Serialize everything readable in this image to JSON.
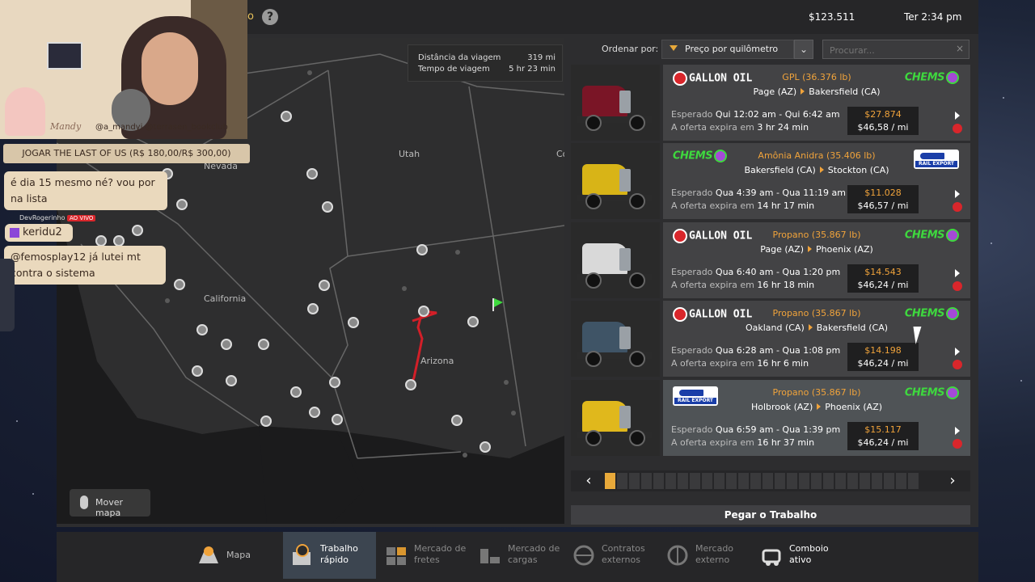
{
  "header": {
    "partial_title": "o",
    "help_label": "?",
    "money": "$123.511",
    "time": "Ter 2:34 pm"
  },
  "map": {
    "info": {
      "distance_label": "Distância da viagem",
      "distance_value": "319 mi",
      "time_label": "Tempo de viagem",
      "time_value": "5 hr 23 min"
    },
    "state_labels": [
      "Nevada",
      "Utah",
      "California",
      "Arizona",
      "Co"
    ],
    "move_map_label": "Mover mapa",
    "route_color": "#d21f28"
  },
  "sort": {
    "label": "Ordenar por:",
    "selected": "Preço por quilômetro",
    "dropdown_icon": "chevron-down",
    "search_placeholder": "Procurar..."
  },
  "jobs": [
    {
      "truck_color": "#7a1526",
      "source_logo": "GALLON OIL",
      "dest_logo": "CHEMS",
      "cargo": "GPL (36.376 lb)",
      "from": "Page (AZ)",
      "to": "Bakersfield (CA)",
      "esp_label": "Esperado",
      "esp_value": "Qui 12:02 am - Qui 6:42 am",
      "exp_label": "A oferta expira em",
      "exp_value": "3 hr 24 min",
      "price": "$27.874",
      "per_mile": "$46,58 / mi"
    },
    {
      "truck_color": "#d8b417",
      "source_logo": "CHEMS",
      "dest_logo": "RAIL EXPORT",
      "cargo": "Amônia Anidra (35.406 lb)",
      "from": "Bakersfield (CA)",
      "to": "Stockton (CA)",
      "esp_label": "Esperado",
      "esp_value": "Qua 4:39 am - Qua 11:19 am",
      "exp_label": "A oferta expira em",
      "exp_value": "14 hr 17 min",
      "price": "$11.028",
      "per_mile": "$46,57 / mi"
    },
    {
      "truck_color": "#d9d9d9",
      "source_logo": "GALLON OIL",
      "dest_logo": "CHEMS",
      "cargo": "Propano (35.867 lb)",
      "from": "Page (AZ)",
      "to": "Phoenix (AZ)",
      "esp_label": "Esperado",
      "esp_value": "Qua 6:40 am - Qua 1:20 pm",
      "exp_label": "A oferta expira em",
      "exp_value": "16 hr 18 min",
      "price": "$14.543",
      "per_mile": "$46,24 / mi"
    },
    {
      "truck_color": "#3f5466",
      "source_logo": "GALLON OIL",
      "dest_logo": "CHEMS",
      "cargo": "Propano (35.867 lb)",
      "from": "Oakland (CA)",
      "to": "Bakersfield (CA)",
      "esp_label": "Esperado",
      "esp_value": "Qua 6:28 am - Qua 1:08 pm",
      "exp_label": "A oferta expira em",
      "exp_value": "16 hr 6 min",
      "price": "$14.198",
      "per_mile": "$46,24 / mi"
    },
    {
      "truck_color": "#e0b81c",
      "source_logo": "RAIL EXPORT",
      "dest_logo": "CHEMS",
      "cargo": "Propano (35.867 lb)",
      "from": "Holbrook (AZ)",
      "to": "Phoenix (AZ)",
      "esp_label": "Esperado",
      "esp_value": "Qua 6:59 am - Qua 1:39 pm",
      "exp_label": "A oferta expira em",
      "exp_value": "16 hr 37 min",
      "price": "$15.117",
      "per_mile": "$46,24 / mi"
    }
  ],
  "pager": {
    "prev": "‹",
    "next": "›",
    "current_page": 1
  },
  "take_job_label": "Pegar o Trabalho",
  "nav": [
    {
      "label": "Mapa",
      "icon": "map-icon",
      "active": false
    },
    {
      "label": "Trabalho rápido",
      "icon": "clock-icon",
      "active": true
    },
    {
      "label": "Mercado de fretes",
      "icon": "freight-icon",
      "active": false
    },
    {
      "label": "Mercado de cargas",
      "icon": "cargo-icon",
      "active": false
    },
    {
      "label": "Contratos externos",
      "icon": "globe-icon",
      "active": false
    },
    {
      "label": "Mercado externo",
      "icon": "globe-icon",
      "active": false
    },
    {
      "label": "Comboio ativo",
      "icon": "convoy-icon",
      "active": false
    }
  ],
  "overlay": {
    "signature": "Mandy",
    "socials": "@a_mandyi @terrasen_bookclub",
    "banner": "JOGAR THE LAST OF US (R$ 180,00/R$ 300,00)",
    "chat1": "é dia 15 mesmo né? vou por na lista",
    "chat_user": "DevRogerinho",
    "live": "AO VIVO",
    "user2": "keridu2",
    "chat2": "@femosplay12 já lutei mt contra o sistema"
  }
}
